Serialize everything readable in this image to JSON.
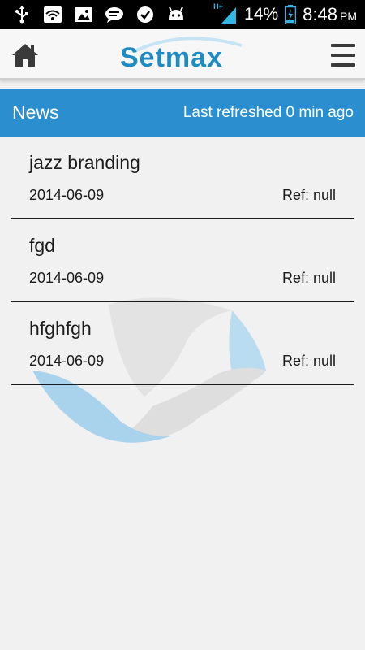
{
  "status_bar": {
    "icons_left": [
      "usb-icon",
      "wifi-icon",
      "image-icon",
      "chat-icon",
      "check-icon",
      "android-icon"
    ],
    "network_label": "H+",
    "battery_percent": "14%",
    "time": "8:48",
    "ampm": "PM"
  },
  "header": {
    "logo_text": "Setmax",
    "home_icon": "home-icon",
    "menu_icon": "menu-icon"
  },
  "section": {
    "title": "News",
    "refreshed": "Last refreshed 0 min ago",
    "color": "#2b8fcf"
  },
  "news": [
    {
      "title": "jazz branding",
      "date": "2014-06-09",
      "ref": "Ref: null"
    },
    {
      "title": "fgd",
      "date": "2014-06-09",
      "ref": "Ref: null"
    },
    {
      "title": "hfghfgh",
      "date": "2014-06-09",
      "ref": "Ref: null"
    }
  ]
}
